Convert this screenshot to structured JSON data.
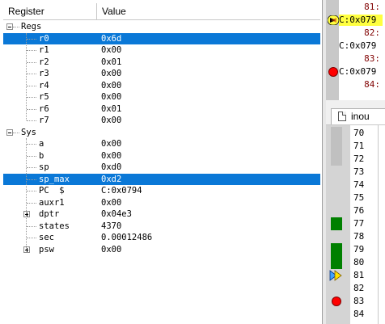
{
  "registers": {
    "header": {
      "col_register": "Register",
      "col_value": "Value"
    },
    "groups": [
      {
        "name": "Regs",
        "expanded": true,
        "items": [
          {
            "name": "r0",
            "value": "0x6d",
            "selected": true
          },
          {
            "name": "r1",
            "value": "0x00"
          },
          {
            "name": "r2",
            "value": "0x01"
          },
          {
            "name": "r3",
            "value": "0x00"
          },
          {
            "name": "r4",
            "value": "0x00"
          },
          {
            "name": "r5",
            "value": "0x00"
          },
          {
            "name": "r6",
            "value": "0x01"
          },
          {
            "name": "r7",
            "value": "0x00"
          }
        ]
      },
      {
        "name": "Sys",
        "expanded": true,
        "items": [
          {
            "name": "a",
            "value": "0x00"
          },
          {
            "name": "b",
            "value": "0x00"
          },
          {
            "name": "sp",
            "value": "0xd0"
          },
          {
            "name": "sp_max",
            "value": "0xd2",
            "selected": true
          },
          {
            "name": "PC  $",
            "value": "C:0x0794"
          },
          {
            "name": "auxr1",
            "value": "0x00"
          },
          {
            "name": "dptr",
            "value": "0x04e3",
            "expandable": true
          },
          {
            "name": "states",
            "value": "4370"
          },
          {
            "name": "sec",
            "value": "0.00012486"
          },
          {
            "name": "psw",
            "value": "0x00",
            "expandable": true
          }
        ]
      }
    ]
  },
  "disassembly": {
    "lines": [
      {
        "num": "81:"
      },
      {
        "addr": "C:0x079",
        "marker": "current",
        "highlight": true
      },
      {
        "num": "82:"
      },
      {
        "addr": "C:0x079"
      },
      {
        "num": "83:"
      },
      {
        "addr": "C:0x079",
        "marker": "breakpoint"
      },
      {
        "num": "84:"
      }
    ]
  },
  "source": {
    "tab_label": "inou",
    "lines": [
      {
        "num": "70",
        "coverage": "light"
      },
      {
        "num": "71",
        "coverage": "light"
      },
      {
        "num": "72",
        "coverage": "light"
      },
      {
        "num": "73",
        "coverage": ""
      },
      {
        "num": "74",
        "coverage": ""
      },
      {
        "num": "75",
        "coverage": ""
      },
      {
        "num": "76",
        "coverage": ""
      },
      {
        "num": "77",
        "coverage": "green"
      },
      {
        "num": "78",
        "coverage": ""
      },
      {
        "num": "79",
        "coverage": "green"
      },
      {
        "num": "80",
        "coverage": "green"
      },
      {
        "num": "81",
        "coverage": "",
        "marker": "current"
      },
      {
        "num": "82",
        "coverage": ""
      },
      {
        "num": "83",
        "coverage": "",
        "marker": "breakpoint"
      },
      {
        "num": "84",
        "coverage": ""
      }
    ]
  },
  "colors": {
    "selection": "#0a78d7",
    "highlight": "#ffff40",
    "coverage_green": "#008000",
    "coverage_light": "#c0c0c0",
    "breakpoint": "#ff0000"
  }
}
